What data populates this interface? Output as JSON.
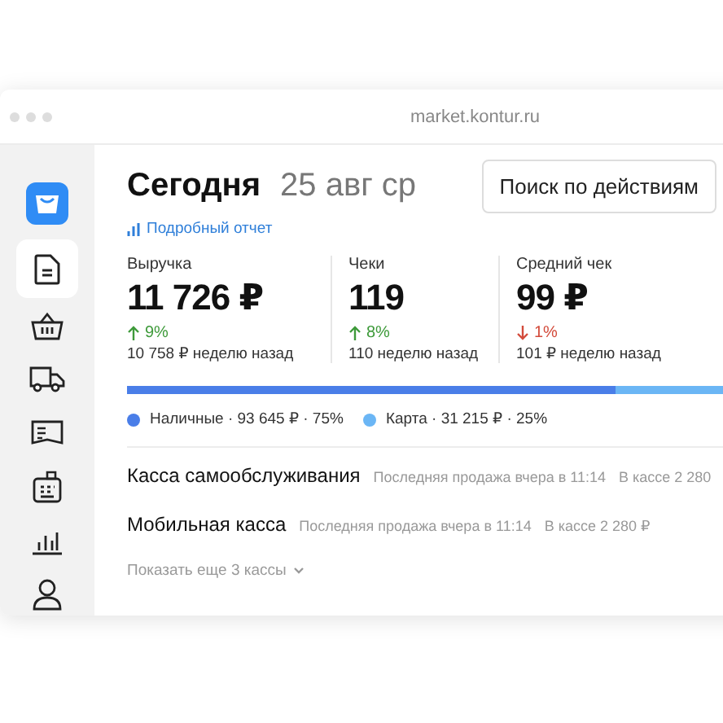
{
  "browser": {
    "url": "market.kontur.ru"
  },
  "sidebar": {
    "items": [
      {
        "kind": "logo",
        "selected": false
      },
      {
        "kind": "document",
        "selected": true
      },
      {
        "kind": "basket",
        "selected": false
      },
      {
        "kind": "truck",
        "selected": false
      },
      {
        "kind": "book",
        "selected": false
      },
      {
        "kind": "register",
        "selected": false
      },
      {
        "kind": "chart",
        "selected": false
      },
      {
        "kind": "user",
        "selected": false
      }
    ]
  },
  "header": {
    "title": "Сегодня",
    "date": "25 авг ср",
    "search_button": "Поиск по действиям",
    "report_link": "Подробный отчет"
  },
  "metrics": [
    {
      "label": "Выручка",
      "value": "11 726 ₽",
      "increase": true,
      "change": "9%",
      "previous": "10 758 ₽ неделю назад"
    },
    {
      "label": "Чеки",
      "value": "119",
      "increase": true,
      "change": "8%",
      "previous": "110 неделю назад"
    },
    {
      "label": "Средний чек",
      "value": "99 ₽",
      "increase": false,
      "change": "1%",
      "previous": "101 ₽ неделю назад"
    }
  ],
  "payment_bar": {
    "level": 0.75
  },
  "legend": [
    {
      "label": "Наличные · 93 645 ₽ · 75%",
      "color": "#4a7ee8"
    },
    {
      "label": "Карта · 31 215 ₽ · 25%",
      "color": "#6bb6f5"
    }
  ],
  "registers": [
    {
      "name": "Касса самообслуживания",
      "last_sale": "Последняя продажа вчера в 11:14",
      "cash": "В кассе 2 280"
    },
    {
      "name": "Мобильная касса",
      "last_sale": "Последняя продажа вчера в 11:14",
      "cash": "В кассе 2 280 ₽"
    }
  ],
  "show_more": "Показать еще 3 кассы"
}
